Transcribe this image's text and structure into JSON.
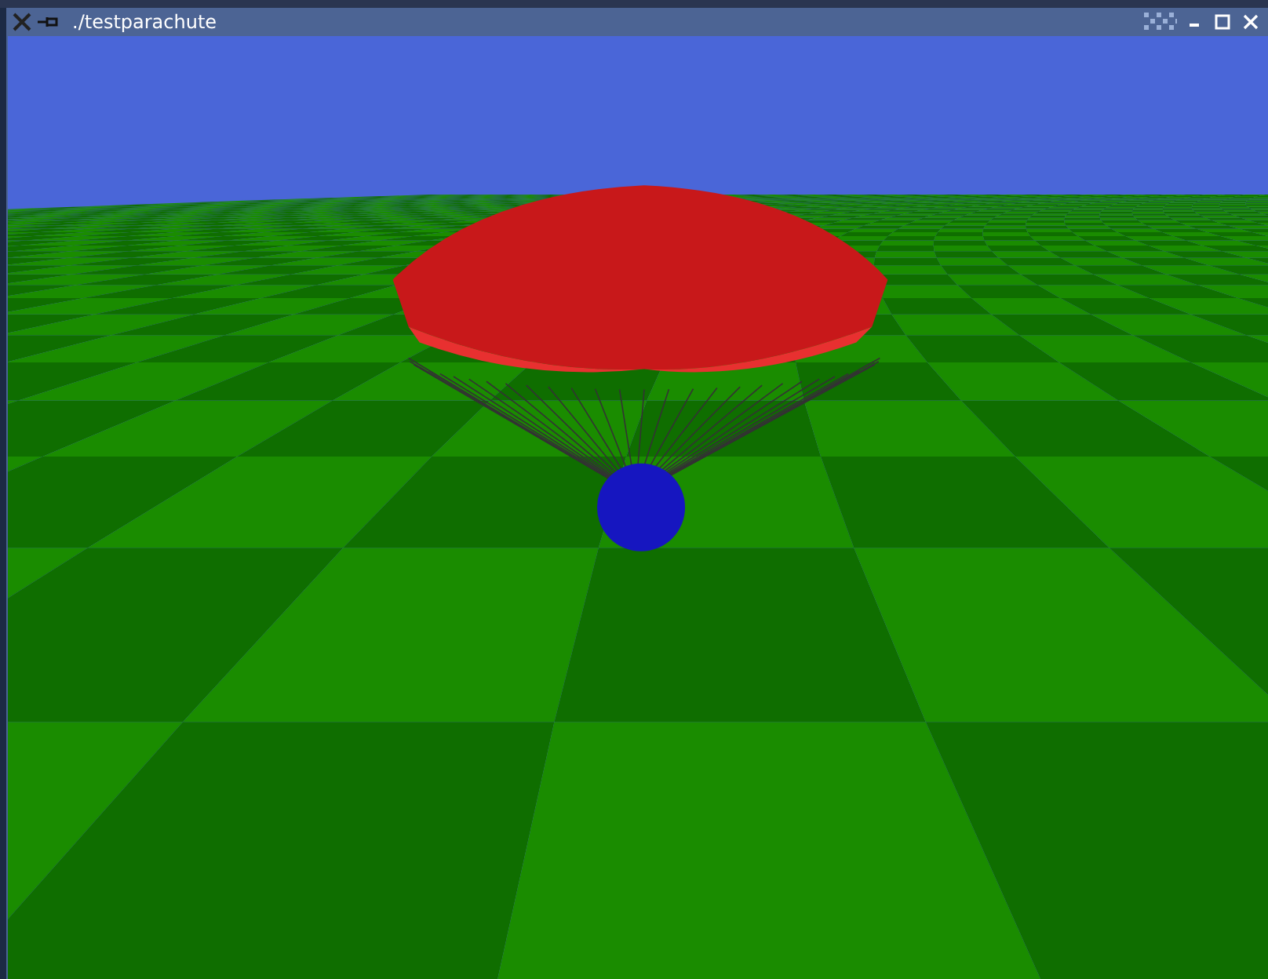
{
  "window": {
    "title": "./testparachute"
  }
}
